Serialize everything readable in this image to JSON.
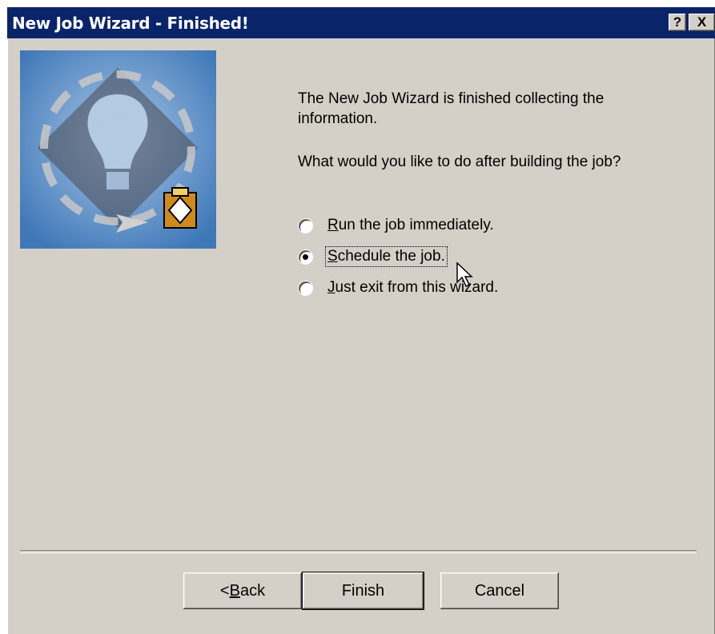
{
  "window": {
    "title": "New Job Wizard - Finished!",
    "help_label": "?",
    "close_label": "X"
  },
  "content": {
    "finished_text": "The New Job Wizard is finished collecting the information.",
    "question_text": "What would you like to do after building the job?"
  },
  "options": [
    {
      "label_accel": "R",
      "label_rest": "un the job immediately.",
      "selected": false
    },
    {
      "label_accel": "S",
      "label_rest": "chedule the job.",
      "selected": true
    },
    {
      "label_accel": "J",
      "label_rest": "ust exit from this wizard.",
      "selected": false
    }
  ],
  "buttons": {
    "back_prefix": "< ",
    "back_accel": "B",
    "back_rest": "ack",
    "finish": "Finish",
    "cancel": "Cancel"
  },
  "icons": {
    "banner": "lightbulb-wizard-banner",
    "clipboard": "clipboard-icon",
    "cursor": "mouse-pointer-icon"
  },
  "colors": {
    "titlebar": "#0a246a",
    "face": "#d4d0c8",
    "banner": "#5b8ec8"
  }
}
